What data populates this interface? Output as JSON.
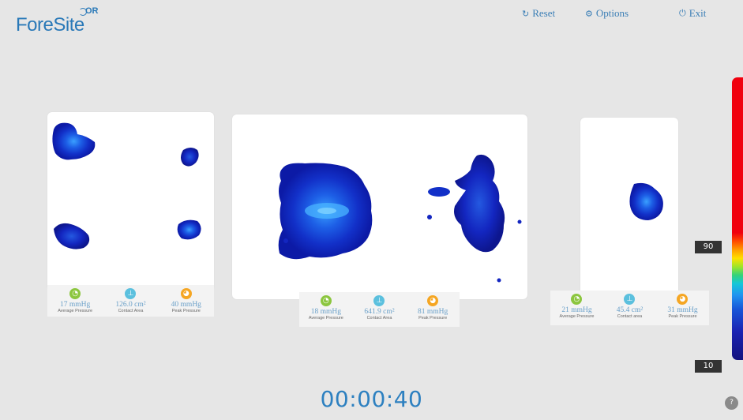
{
  "brand": {
    "name": "ForeSite",
    "badge": "OR"
  },
  "toolbar": {
    "reset": {
      "icon": "refresh-icon",
      "label": "Reset"
    },
    "options": {
      "icon": "gear-icon",
      "label": "Options"
    },
    "exit": {
      "icon": "power-icon",
      "label": "Exit"
    }
  },
  "zones": [
    {
      "avg": "17 mmHg",
      "avg_label": "Average Pressure",
      "area": "126.0 cm²",
      "area_label": "Contact Area",
      "peak": "40 mmHg",
      "peak_label": "Peak Pressure"
    },
    {
      "avg": "18 mmHg",
      "avg_label": "Average Pressure",
      "area": "641.9 cm²",
      "area_label": "Contact Area",
      "peak": "81 mmHg",
      "peak_label": "Peak Pressure"
    },
    {
      "avg": "21 mmHg",
      "avg_label": "Average Pressure",
      "area": "45.4 cm²",
      "area_label": "Contact area",
      "peak": "31 mmHg",
      "peak_label": "Peak Pressure"
    }
  ],
  "timer": "00:00:40",
  "scale": {
    "upper": "90",
    "lower": "10"
  },
  "colors": {
    "accent": "#2d80c0",
    "avg_icon": "#8cc63f",
    "area_icon": "#5bc0de",
    "peak_icon": "#f5a623"
  }
}
